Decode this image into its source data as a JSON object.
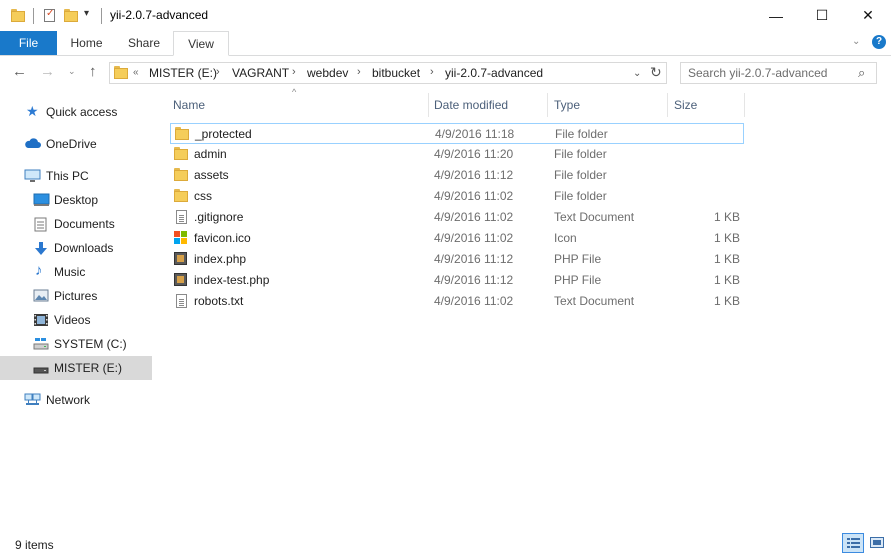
{
  "window": {
    "title": "yii-2.0.7-advanced",
    "controls": {
      "minimize": "—",
      "maximize": "☐",
      "close": "✕"
    }
  },
  "quick_access_toolbar": {
    "dropdown_glyph": "▾"
  },
  "ribbon": {
    "tabs": [
      "File",
      "Home",
      "Share",
      "View"
    ],
    "expand_glyph": "⌄",
    "help_glyph": "?"
  },
  "navigation": {
    "back_glyph": "←",
    "forward_glyph": "→",
    "recent_glyph": "⌄",
    "up_glyph": "↑"
  },
  "address": {
    "overflow_glyph": "«",
    "breadcrumbs": [
      "MISTER (E:)",
      "VAGRANT",
      "webdev",
      "bitbucket",
      "yii-2.0.7-advanced"
    ],
    "separator": "›",
    "dropdown_glyph": "⌄",
    "refresh_glyph": "↻"
  },
  "search": {
    "placeholder": "Search yii-2.0.7-advanced",
    "icon": "search-icon"
  },
  "sidebar": {
    "items": [
      {
        "label": "Quick access",
        "icon": "star-icon"
      },
      {
        "label": "OneDrive",
        "icon": "cloud-icon"
      },
      {
        "label": "This PC",
        "icon": "computer-icon"
      },
      {
        "label": "Desktop",
        "icon": "desktop-icon"
      },
      {
        "label": "Documents",
        "icon": "documents-icon"
      },
      {
        "label": "Downloads",
        "icon": "download-icon"
      },
      {
        "label": "Music",
        "icon": "music-icon"
      },
      {
        "label": "Pictures",
        "icon": "pictures-icon"
      },
      {
        "label": "Videos",
        "icon": "videos-icon"
      },
      {
        "label": "SYSTEM (C:)",
        "icon": "drive-icon"
      },
      {
        "label": "MISTER (E:)",
        "icon": "usb-drive-icon",
        "selected": true
      },
      {
        "label": "Network",
        "icon": "network-icon"
      }
    ]
  },
  "columns": {
    "name": "Name",
    "date_modified": "Date modified",
    "type": "Type",
    "size": "Size",
    "sort_glyph": "^"
  },
  "files": [
    {
      "name": "_protected",
      "date": "4/9/2016 11:18",
      "type": "File folder",
      "size": "",
      "icon": "folder"
    },
    {
      "name": "admin",
      "date": "4/9/2016 11:20",
      "type": "File folder",
      "size": "",
      "icon": "folder"
    },
    {
      "name": "assets",
      "date": "4/9/2016 11:12",
      "type": "File folder",
      "size": "",
      "icon": "folder"
    },
    {
      "name": "css",
      "date": "4/9/2016 11:02",
      "type": "File folder",
      "size": "",
      "icon": "folder"
    },
    {
      "name": ".gitignore",
      "date": "4/9/2016 11:02",
      "type": "Text Document",
      "size": "1 KB",
      "icon": "text"
    },
    {
      "name": "favicon.ico",
      "date": "4/9/2016 11:02",
      "type": "Icon",
      "size": "1 KB",
      "icon": "ico"
    },
    {
      "name": "index.php",
      "date": "4/9/2016 11:12",
      "type": "PHP File",
      "size": "1 KB",
      "icon": "php"
    },
    {
      "name": "index-test.php",
      "date": "4/9/2016 11:12",
      "type": "PHP File",
      "size": "1 KB",
      "icon": "php"
    },
    {
      "name": "robots.txt",
      "date": "4/9/2016 11:02",
      "type": "Text Document",
      "size": "1 KB",
      "icon": "text"
    }
  ],
  "status": {
    "items_text": "9 items"
  },
  "colors": {
    "accent": "#1979ca",
    "selection": "#d9d9d9",
    "focus_border": "#99d1ff",
    "header_text": "#4c607a"
  }
}
